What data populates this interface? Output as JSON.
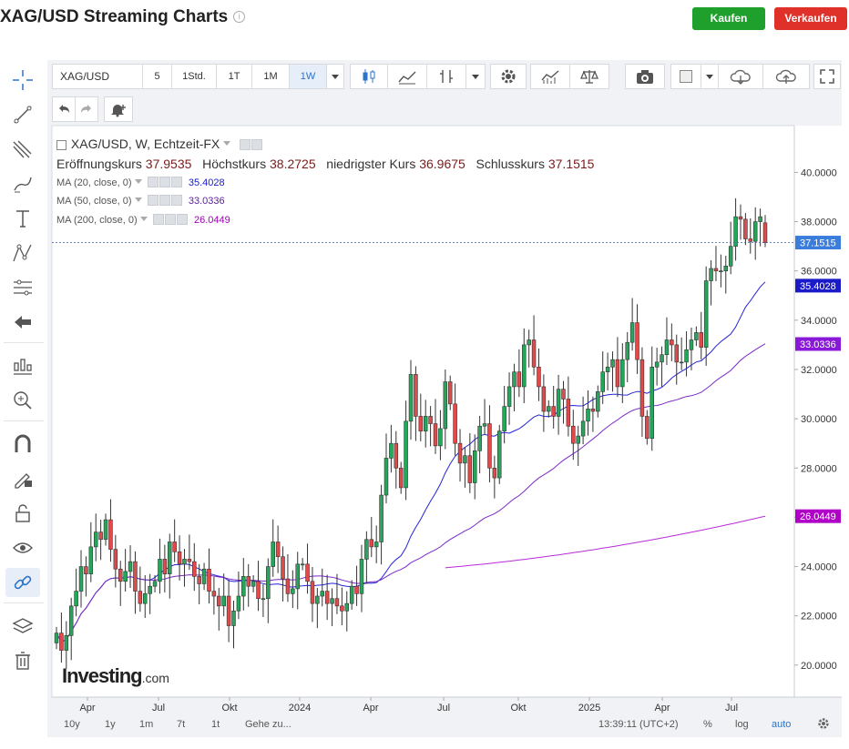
{
  "header": {
    "title": "XAG/USD Streaming Charts",
    "buy_label": "Kaufen",
    "sell_label": "Verkaufen"
  },
  "toolbar": {
    "symbol": "XAG/USD",
    "intervals": [
      "5",
      "1Std.",
      "1T",
      "1M",
      "1W"
    ],
    "active_interval": "1W"
  },
  "legend": {
    "title": "XAG/USD, W, Echtzeit-FX",
    "open_label": "Eröffnungskurs",
    "open": "37.9535",
    "high_label": "Höchstkurs",
    "high": "38.2725",
    "low_label": "niedrigster Kurs",
    "low": "36.9675",
    "close_label": "Schlusskurs",
    "close": "37.1515",
    "ma": [
      {
        "label": "MA (20, close, 0)",
        "value": "35.4028",
        "color": "#1a1ac8"
      },
      {
        "label": "MA (50, close, 0)",
        "value": "33.0336",
        "color": "#6a1ab0"
      },
      {
        "label": "MA (200, close, 0)",
        "value": "26.0449",
        "color": "#b000c8"
      }
    ]
  },
  "bottom_bar": {
    "ranges": [
      "10y",
      "1y",
      "1m",
      "7t",
      "1t"
    ],
    "goto": "Gehe zu...",
    "time": "13:39:11 (UTC+2)",
    "percent": "%",
    "log": "log",
    "auto": "auto"
  },
  "logo": {
    "main": "Investing",
    "suffix": ".com"
  },
  "chart_data": {
    "type": "candlestick",
    "y_ticks": [
      "40.0000",
      "38.0000",
      "36.0000",
      "34.0000",
      "32.0000",
      "30.0000",
      "28.0000",
      "26.0000",
      "24.0000",
      "22.0000",
      "20.0000"
    ],
    "ylim": [
      18.7,
      41.9
    ],
    "x_ticks": [
      "Apr",
      "Jul",
      "Okt",
      "2024",
      "Apr",
      "Jul",
      "Okt",
      "2025",
      "Apr",
      "Jul"
    ],
    "last_price": "37.1515",
    "price_tags": [
      {
        "label": "37.1515",
        "value": 37.1515,
        "color": "#3b7ddd"
      },
      {
        "label": "35.4028",
        "value": 35.4028,
        "color": "#1a1ac8"
      },
      {
        "label": "33.0336",
        "value": 33.0336,
        "color": "#8a18d8"
      },
      {
        "label": "26.0449",
        "value": 26.0449,
        "color": "#b000c8"
      }
    ],
    "up_color": "#26a65b",
    "down_color": "#e04a4a",
    "ma_colors": {
      "ma20": "#2424d8",
      "ma50": "#7a2ac8",
      "ma200": "#b82ad8"
    },
    "closes": [
      21.3,
      20.6,
      21.2,
      22.4,
      23.0,
      24.0,
      23.7,
      24.8,
      25.4,
      25.1,
      25.9,
      24.7,
      23.9,
      23.4,
      23.8,
      24.2,
      23.0,
      22.5,
      22.9,
      23.2,
      23.4,
      24.3,
      23.7,
      25.0,
      24.6,
      24.1,
      24.3,
      24.2,
      23.6,
      23.3,
      23.9,
      23.0,
      22.8,
      22.4,
      22.8,
      21.6,
      22.2,
      22.8,
      23.6,
      23.2,
      23.4,
      22.7,
      22.7,
      24.0,
      25.0,
      24.4,
      23.5,
      22.9,
      23.1,
      24.1,
      24.1,
      23.4,
      22.5,
      22.8,
      23.0,
      22.5,
      22.7,
      22.4,
      22.2,
      22.5,
      23.2,
      22.9,
      24.3,
      25.1,
      24.8,
      25.0,
      26.9,
      28.4,
      29.0,
      28.0,
      27.2,
      29.9,
      31.8,
      30.1,
      29.5,
      30.1,
      29.8,
      28.9,
      29.6,
      31.5,
      30.6,
      29.0,
      28.2,
      28.5,
      27.4,
      28.7,
      29.7,
      29.8,
      28.0,
      27.6,
      29.5,
      30.5,
      31.3,
      31.9,
      31.3,
      33.0,
      33.2,
      32.1,
      31.3,
      30.3,
      30.5,
      30.1,
      31.2,
      30.8,
      29.7,
      29.0,
      29.3,
      29.9,
      30.4,
      30.3,
      31.1,
      31.9,
      32.1,
      32.4,
      31.3,
      32.4,
      33.1,
      33.9,
      32.4,
      30.1,
      29.2,
      32.1,
      32.3,
      32.6,
      33.2,
      33.0,
      32.3,
      32.3,
      32.8,
      33.2,
      33.5,
      32.9,
      35.6,
      36.1,
      36.0,
      36.0,
      36.2,
      37.0,
      38.2,
      38.1,
      37.3,
      37.2,
      38.0,
      38.2,
      37.15
    ]
  }
}
